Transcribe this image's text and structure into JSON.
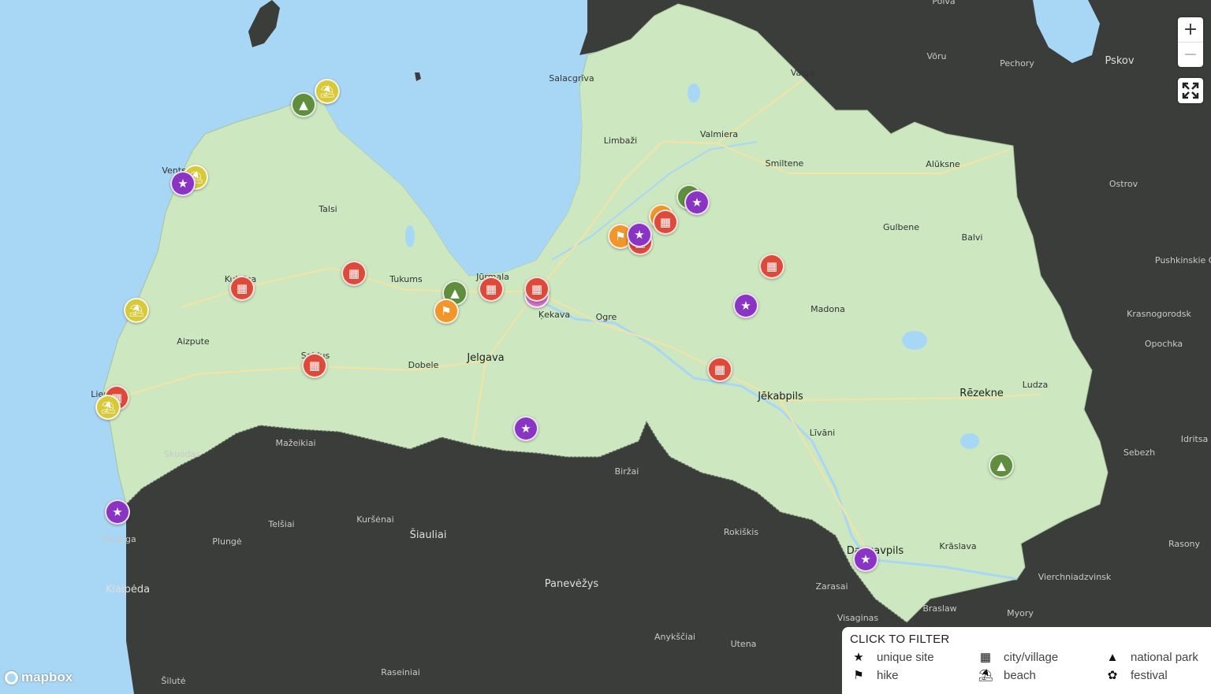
{
  "colors": {
    "water": "#a8d7f5",
    "land": "#cde8c0",
    "other_land": "#3b3d3b",
    "unique_site": "#8a34c4",
    "city": "#dd4a3a",
    "park": "#5f8e3e",
    "beach": "#d8c93a",
    "hike": "#f0962a"
  },
  "places": [
    {
      "name": "Salacgrīva",
      "big": false
    },
    {
      "name": "Limbaži",
      "big": false
    },
    {
      "name": "Valmiera",
      "big": false
    },
    {
      "name": "Valga",
      "big": false
    },
    {
      "name": "Smiltene",
      "big": false
    },
    {
      "name": "Alūksne",
      "big": false
    },
    {
      "name": "Gulbene",
      "big": false
    },
    {
      "name": "Balvi",
      "big": false
    },
    {
      "name": "Talsi",
      "big": false
    },
    {
      "name": "Tukums",
      "big": false
    },
    {
      "name": "Jūrmala",
      "big": false
    },
    {
      "name": "Ķekava",
      "big": false
    },
    {
      "name": "Ogre",
      "big": false
    },
    {
      "name": "Madona",
      "big": false
    },
    {
      "name": "Aizpute",
      "big": false
    },
    {
      "name": "Dobele",
      "big": false
    },
    {
      "name": "Jelgava",
      "big": true
    },
    {
      "name": "Jēkabpils",
      "big": true
    },
    {
      "name": "Rēzekne",
      "big": true
    },
    {
      "name": "Ludza",
      "big": false
    },
    {
      "name": "Līvāni",
      "big": false
    },
    {
      "name": "Kuldīga",
      "big": false
    },
    {
      "name": "Saldus",
      "big": false
    },
    {
      "name": "Ventspils",
      "big": false
    },
    {
      "name": "Liepāja",
      "big": false
    },
    {
      "name": "Daugavpils",
      "big": true
    },
    {
      "name": "Krāslava",
      "big": false
    }
  ],
  "foreign_places": [
    {
      "name": "Põlva",
      "big": false
    },
    {
      "name": "Võru",
      "big": false
    },
    {
      "name": "Pechory",
      "big": false
    },
    {
      "name": "Pskov",
      "big": true
    },
    {
      "name": "Ostrov",
      "big": false
    },
    {
      "name": "Pushkinskie Gory",
      "big": false
    },
    {
      "name": "Krasnogorodsk",
      "big": false
    },
    {
      "name": "Opochka",
      "big": false
    },
    {
      "name": "Idritsa",
      "big": false
    },
    {
      "name": "Sebezh",
      "big": false
    },
    {
      "name": "Rasony",
      "big": false
    },
    {
      "name": "Vierchniadzvinsk",
      "big": false
    },
    {
      "name": "Myory",
      "big": false
    },
    {
      "name": "Braslaw",
      "big": false
    },
    {
      "name": "Zarasai",
      "big": false
    },
    {
      "name": "Visaginas",
      "big": false
    },
    {
      "name": "Rokiškis",
      "big": false
    },
    {
      "name": "Biržai",
      "big": false
    },
    {
      "name": "Panevėžys",
      "big": true
    },
    {
      "name": "Šiauliai",
      "big": true
    },
    {
      "name": "Kuršėnai",
      "big": false
    },
    {
      "name": "Telšiai",
      "big": false
    },
    {
      "name": "Plungė",
      "big": false
    },
    {
      "name": "Mažeikiai",
      "big": false
    },
    {
      "name": "Skuodas",
      "big": false
    },
    {
      "name": "Palanga",
      "big": false
    },
    {
      "name": "Klaipėda",
      "big": true
    },
    {
      "name": "Šilutė",
      "big": false
    },
    {
      "name": "Raseiniai",
      "big": false
    },
    {
      "name": "Anykščiai",
      "big": false
    },
    {
      "name": "Utena",
      "big": false
    }
  ],
  "markers": [
    {
      "type": "beach",
      "icon": "⛱"
    },
    {
      "type": "park",
      "icon": "▲"
    },
    {
      "type": "beach",
      "icon": "⛱"
    },
    {
      "type": "unique_site",
      "icon": "★"
    },
    {
      "type": "city",
      "icon": "▦"
    },
    {
      "type": "city",
      "icon": "▦"
    },
    {
      "type": "beach",
      "icon": "⛱"
    },
    {
      "type": "city",
      "icon": "▦"
    },
    {
      "type": "beach",
      "icon": "⛱"
    },
    {
      "type": "city",
      "icon": "▦"
    },
    {
      "type": "unique_site",
      "icon": "★"
    },
    {
      "type": "park",
      "icon": "▲"
    },
    {
      "type": "hike",
      "icon": "⚑"
    },
    {
      "type": "city",
      "icon": "▦"
    },
    {
      "type": "festival",
      "icon": "✿"
    },
    {
      "type": "city",
      "icon": "▦"
    },
    {
      "type": "unique_site",
      "icon": "★"
    },
    {
      "type": "hike",
      "icon": "⚑"
    },
    {
      "type": "city",
      "icon": "▦"
    },
    {
      "type": "hike",
      "icon": "⚑"
    },
    {
      "type": "unique_site",
      "icon": "★"
    },
    {
      "type": "city",
      "icon": "▦"
    },
    {
      "type": "park",
      "icon": "▲"
    },
    {
      "type": "unique_site",
      "icon": "★"
    },
    {
      "type": "city",
      "icon": "▦"
    },
    {
      "type": "unique_site",
      "icon": "★"
    },
    {
      "type": "city",
      "icon": "▦"
    },
    {
      "type": "park",
      "icon": "▲"
    },
    {
      "type": "unique_site",
      "icon": "★"
    }
  ],
  "controls": {
    "zoom_in": "+",
    "zoom_out": "−",
    "fullscreen_icon": "fullscreen-icon"
  },
  "legend": {
    "title": "CLICK TO FILTER",
    "items": [
      {
        "label": "unique site",
        "icon": "★",
        "icon_name": "star-icon"
      },
      {
        "label": "city/village",
        "icon": "▦",
        "icon_name": "building-icon"
      },
      {
        "label": "national park",
        "icon": "▲",
        "icon_name": "tree-icon"
      },
      {
        "label": "hike",
        "icon": "⚑",
        "icon_name": "hiker-icon"
      },
      {
        "label": "beach",
        "icon": "⛱",
        "icon_name": "umbrella-icon"
      },
      {
        "label": "festival",
        "icon": "✿",
        "icon_name": "festival-icon"
      }
    ]
  },
  "attribution": {
    "logo_text": "mapbox"
  }
}
